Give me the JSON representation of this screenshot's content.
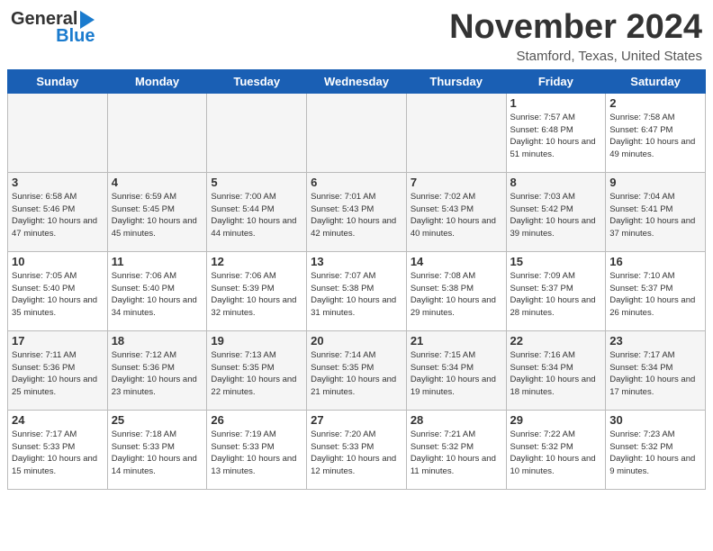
{
  "header": {
    "logo_general": "General",
    "logo_blue": "Blue",
    "title": "November 2024",
    "subtitle": "Stamford, Texas, United States"
  },
  "calendar": {
    "days_of_week": [
      "Sunday",
      "Monday",
      "Tuesday",
      "Wednesday",
      "Thursday",
      "Friday",
      "Saturday"
    ],
    "weeks": [
      [
        {
          "num": "",
          "info": ""
        },
        {
          "num": "",
          "info": ""
        },
        {
          "num": "",
          "info": ""
        },
        {
          "num": "",
          "info": ""
        },
        {
          "num": "",
          "info": ""
        },
        {
          "num": "1",
          "info": "Sunrise: 7:57 AM\nSunset: 6:48 PM\nDaylight: 10 hours and 51 minutes."
        },
        {
          "num": "2",
          "info": "Sunrise: 7:58 AM\nSunset: 6:47 PM\nDaylight: 10 hours and 49 minutes."
        }
      ],
      [
        {
          "num": "3",
          "info": "Sunrise: 6:58 AM\nSunset: 5:46 PM\nDaylight: 10 hours and 47 minutes."
        },
        {
          "num": "4",
          "info": "Sunrise: 6:59 AM\nSunset: 5:45 PM\nDaylight: 10 hours and 45 minutes."
        },
        {
          "num": "5",
          "info": "Sunrise: 7:00 AM\nSunset: 5:44 PM\nDaylight: 10 hours and 44 minutes."
        },
        {
          "num": "6",
          "info": "Sunrise: 7:01 AM\nSunset: 5:43 PM\nDaylight: 10 hours and 42 minutes."
        },
        {
          "num": "7",
          "info": "Sunrise: 7:02 AM\nSunset: 5:43 PM\nDaylight: 10 hours and 40 minutes."
        },
        {
          "num": "8",
          "info": "Sunrise: 7:03 AM\nSunset: 5:42 PM\nDaylight: 10 hours and 39 minutes."
        },
        {
          "num": "9",
          "info": "Sunrise: 7:04 AM\nSunset: 5:41 PM\nDaylight: 10 hours and 37 minutes."
        }
      ],
      [
        {
          "num": "10",
          "info": "Sunrise: 7:05 AM\nSunset: 5:40 PM\nDaylight: 10 hours and 35 minutes."
        },
        {
          "num": "11",
          "info": "Sunrise: 7:06 AM\nSunset: 5:40 PM\nDaylight: 10 hours and 34 minutes."
        },
        {
          "num": "12",
          "info": "Sunrise: 7:06 AM\nSunset: 5:39 PM\nDaylight: 10 hours and 32 minutes."
        },
        {
          "num": "13",
          "info": "Sunrise: 7:07 AM\nSunset: 5:38 PM\nDaylight: 10 hours and 31 minutes."
        },
        {
          "num": "14",
          "info": "Sunrise: 7:08 AM\nSunset: 5:38 PM\nDaylight: 10 hours and 29 minutes."
        },
        {
          "num": "15",
          "info": "Sunrise: 7:09 AM\nSunset: 5:37 PM\nDaylight: 10 hours and 28 minutes."
        },
        {
          "num": "16",
          "info": "Sunrise: 7:10 AM\nSunset: 5:37 PM\nDaylight: 10 hours and 26 minutes."
        }
      ],
      [
        {
          "num": "17",
          "info": "Sunrise: 7:11 AM\nSunset: 5:36 PM\nDaylight: 10 hours and 25 minutes."
        },
        {
          "num": "18",
          "info": "Sunrise: 7:12 AM\nSunset: 5:36 PM\nDaylight: 10 hours and 23 minutes."
        },
        {
          "num": "19",
          "info": "Sunrise: 7:13 AM\nSunset: 5:35 PM\nDaylight: 10 hours and 22 minutes."
        },
        {
          "num": "20",
          "info": "Sunrise: 7:14 AM\nSunset: 5:35 PM\nDaylight: 10 hours and 21 minutes."
        },
        {
          "num": "21",
          "info": "Sunrise: 7:15 AM\nSunset: 5:34 PM\nDaylight: 10 hours and 19 minutes."
        },
        {
          "num": "22",
          "info": "Sunrise: 7:16 AM\nSunset: 5:34 PM\nDaylight: 10 hours and 18 minutes."
        },
        {
          "num": "23",
          "info": "Sunrise: 7:17 AM\nSunset: 5:34 PM\nDaylight: 10 hours and 17 minutes."
        }
      ],
      [
        {
          "num": "24",
          "info": "Sunrise: 7:17 AM\nSunset: 5:33 PM\nDaylight: 10 hours and 15 minutes."
        },
        {
          "num": "25",
          "info": "Sunrise: 7:18 AM\nSunset: 5:33 PM\nDaylight: 10 hours and 14 minutes."
        },
        {
          "num": "26",
          "info": "Sunrise: 7:19 AM\nSunset: 5:33 PM\nDaylight: 10 hours and 13 minutes."
        },
        {
          "num": "27",
          "info": "Sunrise: 7:20 AM\nSunset: 5:33 PM\nDaylight: 10 hours and 12 minutes."
        },
        {
          "num": "28",
          "info": "Sunrise: 7:21 AM\nSunset: 5:32 PM\nDaylight: 10 hours and 11 minutes."
        },
        {
          "num": "29",
          "info": "Sunrise: 7:22 AM\nSunset: 5:32 PM\nDaylight: 10 hours and 10 minutes."
        },
        {
          "num": "30",
          "info": "Sunrise: 7:23 AM\nSunset: 5:32 PM\nDaylight: 10 hours and 9 minutes."
        }
      ]
    ]
  }
}
